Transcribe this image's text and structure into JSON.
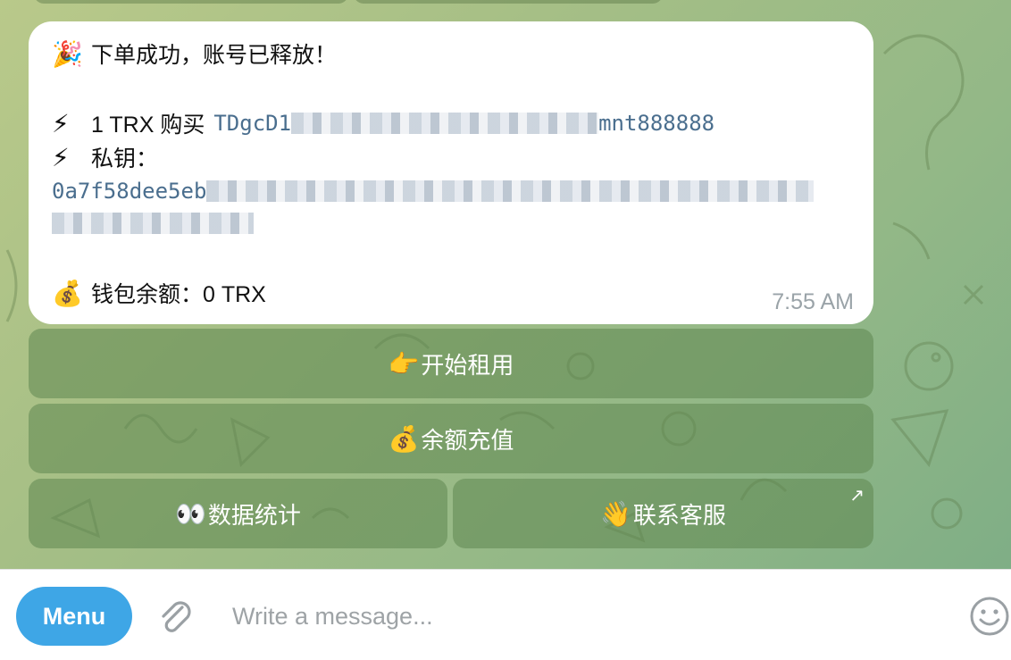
{
  "message": {
    "title_emoji": "🎉",
    "title": "下单成功，账号已释放！",
    "buy_emoji": "⚡",
    "buy_label": "1 TRX 购买",
    "address_prefix": "TDgcD1",
    "address_suffix": "mnt888888",
    "key_emoji": "⚡",
    "key_label": "私钥：",
    "key_prefix": "0a7f58dee5eb",
    "balance_emoji": "💰",
    "balance_label": "钱包余额：0 TRX",
    "time": "7:55 AM"
  },
  "keyboard": {
    "start_emoji": "👉",
    "start_label": "开始租用",
    "recharge_emoji": "💰",
    "recharge_label": "余额充值",
    "stats_emoji": "👀",
    "stats_label": "数据统计",
    "contact_emoji": "👋",
    "contact_label": "联系客服",
    "contact_icon": "external-link-arrow"
  },
  "input_bar": {
    "menu_label": "Menu",
    "placeholder": "Write a message...",
    "attach_icon": "paperclip",
    "emoji_icon": "smiley"
  },
  "colors": {
    "menu_button": "#3ea6e6",
    "link_text": "#4a6e8e",
    "time_text": "#9aa3a8"
  }
}
